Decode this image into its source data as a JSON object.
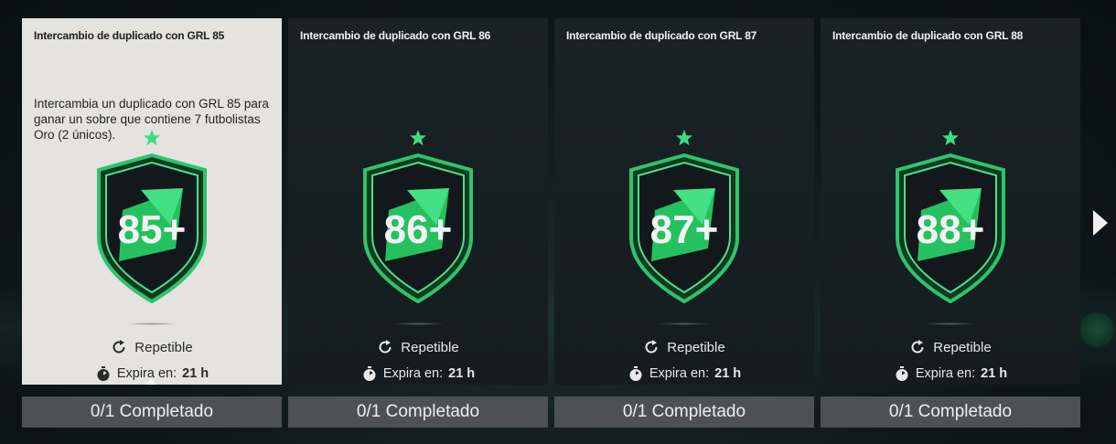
{
  "cards": [
    {
      "title": "Intercambio de duplicado con GRL 85",
      "description": "Intercambia un duplicado con GRL 85 para ganar un sobre que contiene 7 futbolistas Oro (2 únicos).",
      "rating": "85+",
      "repeat_label": "Repetible",
      "expire_label": "Expira en:",
      "expire_value": "21 h",
      "progress_label": "0/1 Completado",
      "selected": true
    },
    {
      "title": "Intercambio de duplicado con GRL 86",
      "description": "",
      "rating": "86+",
      "repeat_label": "Repetible",
      "expire_label": "Expira en:",
      "expire_value": "21 h",
      "progress_label": "0/1 Completado",
      "selected": false
    },
    {
      "title": "Intercambio de duplicado con GRL 87",
      "description": "",
      "rating": "87+",
      "repeat_label": "Repetible",
      "expire_label": "Expira en:",
      "expire_value": "21 h",
      "progress_label": "0/1 Completado",
      "selected": false
    },
    {
      "title": "Intercambio de duplicado con GRL 88",
      "description": "",
      "rating": "88+",
      "repeat_label": "Repetible",
      "expire_label": "Expira en:",
      "expire_value": "21 h",
      "progress_label": "0/1 Completado",
      "selected": false
    }
  ],
  "icons": {
    "star": "star-icon",
    "repeat": "repeat-icon",
    "timer": "stopwatch-icon",
    "next": "chevron-right-icon"
  },
  "colors": {
    "accent_green": "#3ddc84",
    "selected_card_bg": "#e4e3df",
    "card_bg": "#172022",
    "progress_bar_bg": "#4c5253"
  }
}
